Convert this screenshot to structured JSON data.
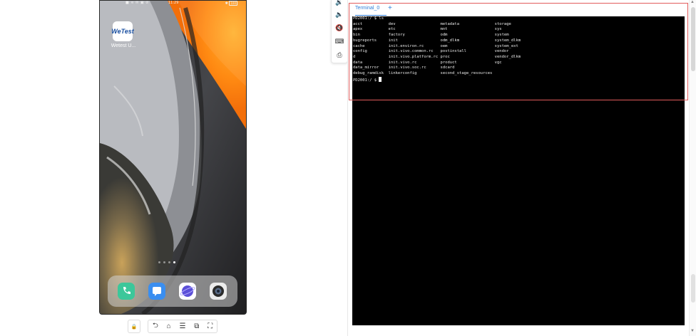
{
  "phone": {
    "status": {
      "left": "■ ≋ ✉ ▣ ⊘",
      "time": "11:29",
      "right": "✱",
      "battery": "100"
    },
    "apps": [
      {
        "name": "WeTest",
        "logo_text": "WeTest",
        "label": "Wetest U..."
      }
    ],
    "page_dots": {
      "count": 4,
      "active_index": 3
    },
    "dock": [
      {
        "icon": "phone-icon",
        "color": "#3cc79a"
      },
      {
        "icon": "messages-icon",
        "color": "#3a8ef0"
      },
      {
        "icon": "browser-icon",
        "color": "#5b4fd8"
      },
      {
        "icon": "camera-icon",
        "color": "#2b2b2b"
      }
    ]
  },
  "phone_controls": [
    {
      "icon": "lock-icon",
      "glyph": "🔒"
    },
    {
      "icon": "back-icon",
      "glyph": "⮌"
    },
    {
      "icon": "home-icon",
      "glyph": "⌂"
    },
    {
      "icon": "menu-icon",
      "glyph": "☰"
    },
    {
      "icon": "screen-rotate-icon",
      "glyph": "⧉"
    },
    {
      "icon": "fullscreen-icon",
      "glyph": "⛶"
    }
  ],
  "side_toolbar": [
    {
      "icon": "volume-down-icon",
      "glyph": "🔉"
    },
    {
      "icon": "volume-up-icon",
      "glyph": "🔈"
    },
    {
      "icon": "mute-icon",
      "glyph": "🔇"
    },
    {
      "icon": "keyboard-icon",
      "glyph": "⌨"
    },
    {
      "icon": "screenshot-icon",
      "glyph": "⎙"
    }
  ],
  "terminal": {
    "tab_label": "Terminal_0",
    "add_label": "+",
    "lines": [
      "PD2001:/ $ ls",
      "acct           dev                   metadata               storage",
      "apex           etc                   mnt                    sys",
      "bin            factory               odm                    system",
      "bugreports     init                  odm_dlkm               system_dlkm",
      "cache          init.environ.rc       oem                    system_ext",
      "config         init.vivo.common.rc   postinstall            vendor",
      "d              init.vivo.platform.rc proc                   vendor_dlkm",
      "data           init.vivo.rc          product                vgc",
      "data_mirror    init.vivo.soc.rc      sdcard",
      "debug_ramdisk  linkerconfig          second_stage_resources"
    ],
    "prompt": "PD2001:/ $ "
  },
  "colors": {
    "accent": "#2f7ed8",
    "highlight": "#e15c5c",
    "terminal_bg": "#000000"
  }
}
